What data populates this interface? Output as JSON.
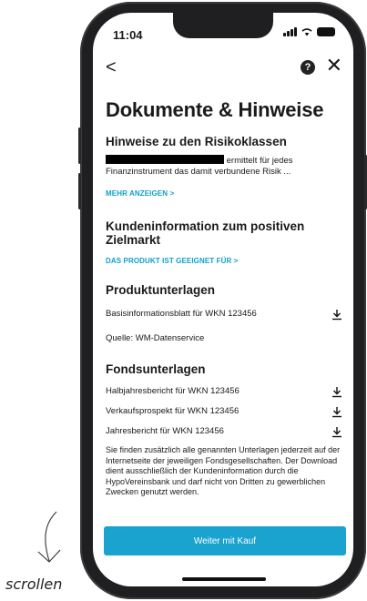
{
  "status_bar": {
    "time": "11:04"
  },
  "nav": {
    "back_label": "<",
    "help_label": "?",
    "close_label": "✕"
  },
  "page_title": "Dokumente & Hinweise",
  "risk": {
    "title": "Hinweise zu den Risikoklassen",
    "text_line1_suffix": "ermittelt für jedes",
    "text_line2": "Finanzinstrument das damit verbundene Risik ...",
    "more_link": "MEHR ANZEIGEN >"
  },
  "target_market": {
    "title": "Kundeninformation zum positiven Zielmarkt",
    "link": "DAS PRODUKT IST GEEIGNET FÜR >"
  },
  "product_docs": {
    "title": "Produktunterlagen",
    "items": [
      {
        "label": "Basisinformationsblatt für WKN 123456"
      }
    ],
    "source": "Quelle: WM-Datenservice"
  },
  "fund_docs": {
    "title": "Fondsunterlagen",
    "items": [
      {
        "label": "Halbjahresbericht für WKN 123456"
      },
      {
        "label": "Verkaufsprospekt für WKN 123456"
      },
      {
        "label": "Jahresbericht für WKN 123456"
      }
    ],
    "note": "Sie finden zusätzlich alle genannten Unterlagen jederzeit auf der Internetseite der jeweiligen Fondsgesellschaften. Der Download dient ausschließlich der Kundeninformation durch die HypoVereinsbank und darf nicht von Dritten zu gewerblichen Zwecken genutzt werden."
  },
  "cta": {
    "label": "Weiter mit Kauf"
  },
  "annotation": {
    "label": "scrollen"
  },
  "icons": {
    "back": "chevron-left-icon",
    "help": "help-icon",
    "close": "close-icon",
    "download": "download-icon"
  },
  "colors": {
    "accent": "#1aa3cf",
    "link": "#0f9fc8"
  }
}
